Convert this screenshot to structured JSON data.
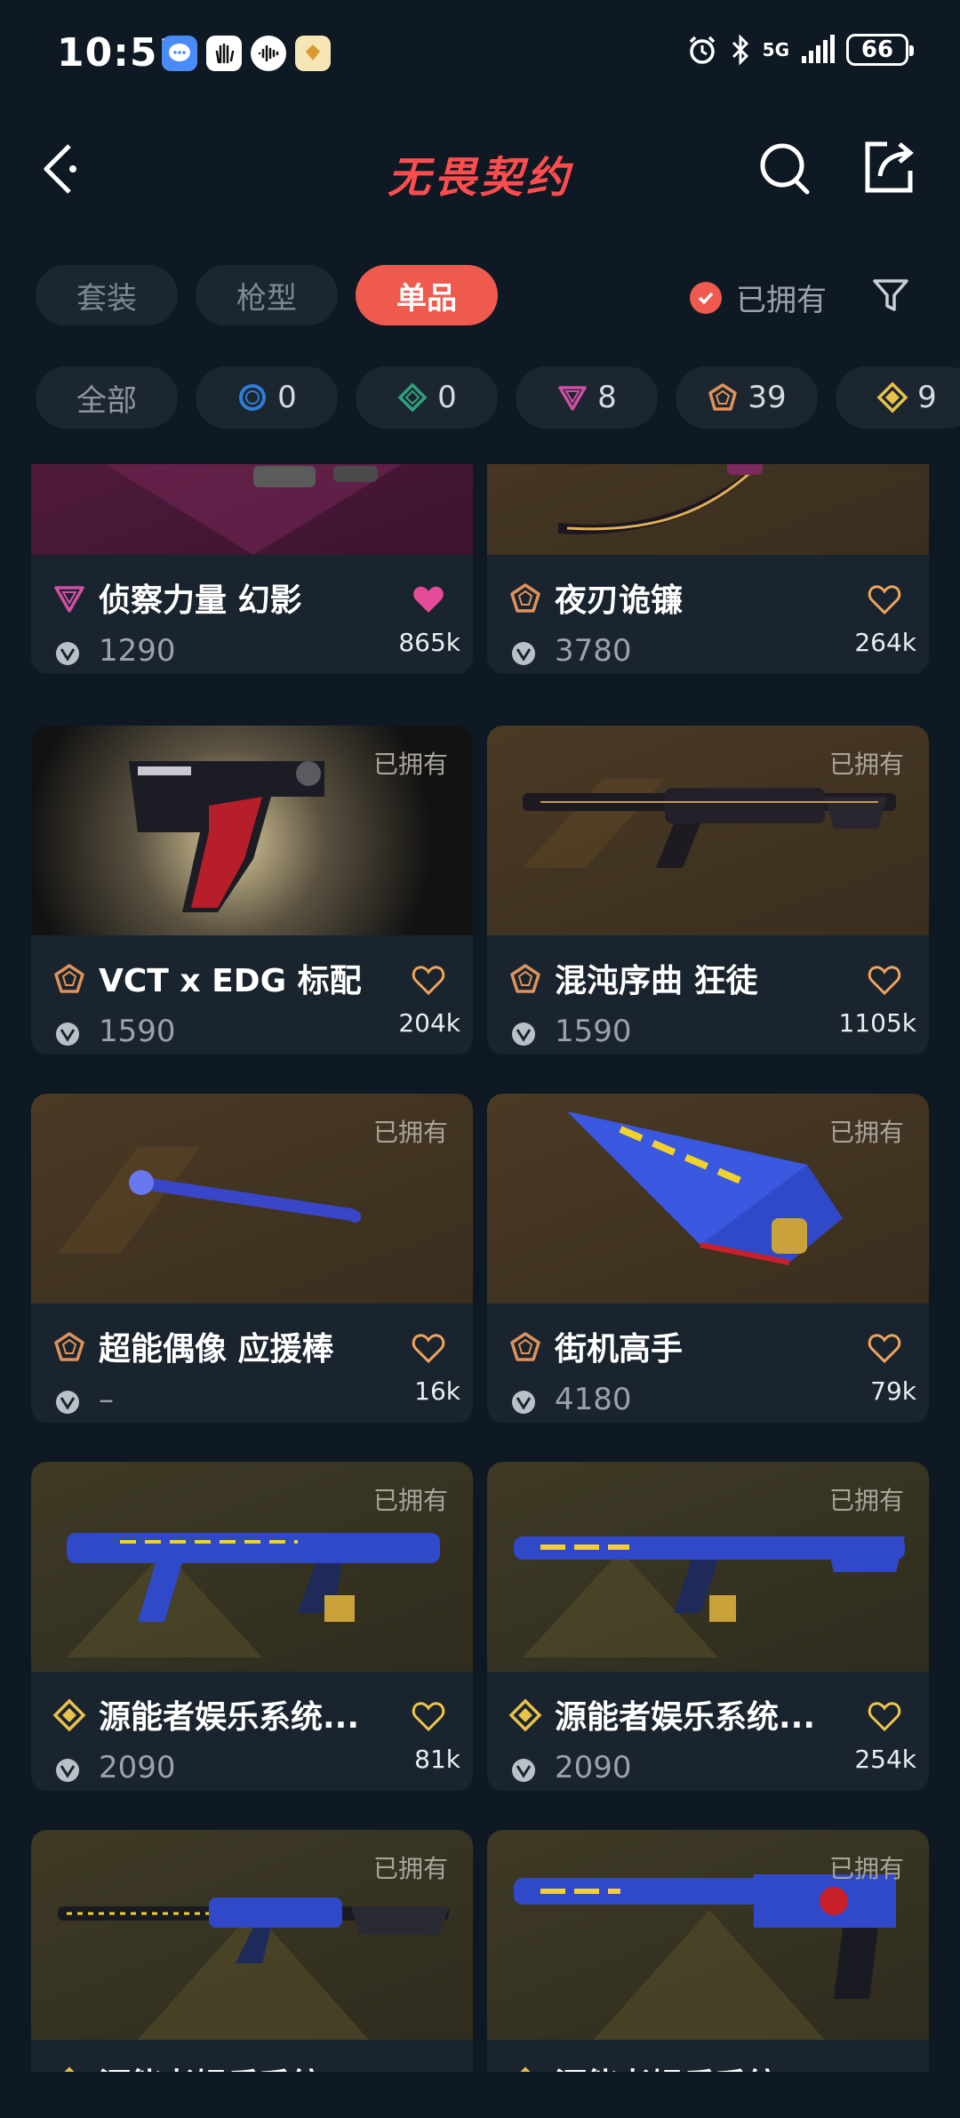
{
  "status": {
    "time": "10:51",
    "battery": "66",
    "network": "5G"
  },
  "nav": {
    "title": "无畏契约"
  },
  "segments": [
    {
      "label": "套装"
    },
    {
      "label": "枪型"
    },
    {
      "label": "单品"
    }
  ],
  "owned_filter_label": "已拥有",
  "rarity_filters": [
    {
      "label": "全部"
    },
    {
      "count": "0",
      "color": "#2f7dd6",
      "icon": "select-tier-icon"
    },
    {
      "count": "0",
      "color": "#2fa27f",
      "icon": "deluxe-tier-icon"
    },
    {
      "count": "8",
      "color": "#d04fa5",
      "icon": "premium-tier-icon"
    },
    {
      "count": "39",
      "color": "#e0925a",
      "icon": "exclusive-tier-icon"
    },
    {
      "count": "9",
      "color": "#e8c24a",
      "icon": "ultra-tier-icon"
    }
  ],
  "items": [
    {
      "name": "侦察力量 幻影",
      "price": "1290",
      "likes": "865k",
      "tier_color": "#d04fa5",
      "owned": "",
      "favorited": true
    },
    {
      "name": "夜刃诡镰",
      "price": "3780",
      "likes": "264k",
      "tier_color": "#e0925a",
      "owned": "",
      "favorited": false
    },
    {
      "name": "VCT x EDG 标配",
      "price": "1590",
      "likes": "204k",
      "tier_color": "#e0925a",
      "owned": "已拥有",
      "favorited": false
    },
    {
      "name": "混沌序曲 狂徒",
      "price": "1590",
      "likes": "1105k",
      "tier_color": "#e0925a",
      "owned": "已拥有",
      "favorited": false
    },
    {
      "name": "超能偶像 应援棒",
      "price": "–",
      "likes": "16k",
      "tier_color": "#e0925a",
      "owned": "已拥有",
      "favorited": false
    },
    {
      "name": "街机高手",
      "price": "4180",
      "likes": "79k",
      "tier_color": "#e0925a",
      "owned": "已拥有",
      "favorited": false
    },
    {
      "name": "源能者娱乐系统...",
      "price": "2090",
      "likes": "81k",
      "tier_color": "#e8c24a",
      "owned": "已拥有",
      "favorited": false
    },
    {
      "name": "源能者娱乐系统...",
      "price": "2090",
      "likes": "254k",
      "tier_color": "#e8c24a",
      "owned": "已拥有",
      "favorited": false
    },
    {
      "name": "源能者娱乐系统...",
      "price": "",
      "likes": "",
      "tier_color": "#e8c24a",
      "owned": "已拥有",
      "favorited": false
    },
    {
      "name": "源能者娱乐系统...",
      "price": "",
      "likes": "",
      "tier_color": "#e8c24a",
      "owned": "已拥有",
      "favorited": false
    }
  ]
}
